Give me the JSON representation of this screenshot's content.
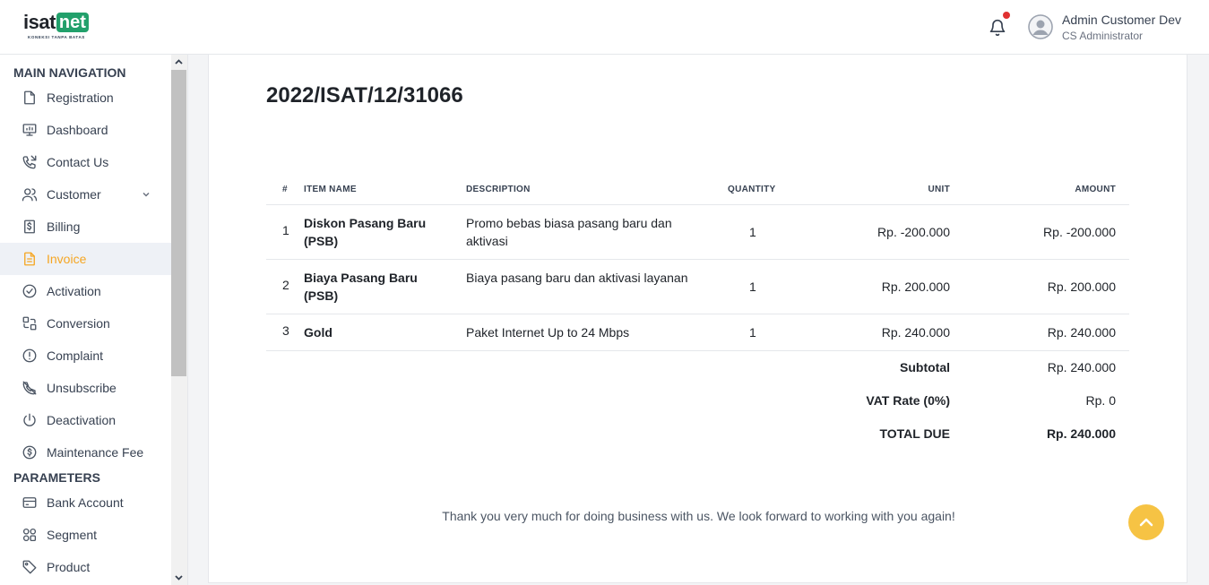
{
  "header": {
    "logo_text_left": "isat",
    "logo_text_right": "net",
    "logo_tagline": "KONEKSI TANPA BATAS",
    "user_name": "Admin Customer Dev",
    "user_role": "CS Administrator"
  },
  "sidebar": {
    "sections": [
      {
        "title": "MAIN NAVIGATION"
      },
      {
        "title": "PARAMETERS"
      }
    ],
    "items": [
      {
        "label": "Registration",
        "icon": "file-icon"
      },
      {
        "label": "Dashboard",
        "icon": "monitor-chart-icon"
      },
      {
        "label": "Contact Us",
        "icon": "phone-call-icon"
      },
      {
        "label": "Customer",
        "icon": "users-icon"
      },
      {
        "label": "Billing",
        "icon": "billing-dollar-icon"
      },
      {
        "label": "Invoice",
        "icon": "invoice-file-icon"
      },
      {
        "label": "Activation",
        "icon": "check-circle-icon"
      },
      {
        "label": "Conversion",
        "icon": "conversion-icon"
      },
      {
        "label": "Complaint",
        "icon": "alert-circle-icon"
      },
      {
        "label": "Unsubscribe",
        "icon": "phone-off-icon"
      },
      {
        "label": "Deactivation",
        "icon": "power-icon"
      },
      {
        "label": "Maintenance Fee",
        "icon": "dollar-circle-icon"
      },
      {
        "label": "Bank Account",
        "icon": "credit-card-icon"
      },
      {
        "label": "Segment",
        "icon": "grid-icon"
      },
      {
        "label": "Product",
        "icon": "tag-icon"
      }
    ],
    "active_item": "Invoice",
    "accent_color": "#f5a623"
  },
  "invoice": {
    "number": "2022/ISAT/12/31066",
    "columns": [
      "#",
      "ITEM NAME",
      "DESCRIPTION",
      "QUANTITY",
      "UNIT",
      "AMOUNT"
    ],
    "rows": [
      {
        "no": "1",
        "item": "Diskon Pasang Baru (PSB)",
        "description": "Promo bebas biasa pasang baru dan aktivasi",
        "quantity": "1",
        "unit": "Rp. -200.000",
        "amount": "Rp. -200.000"
      },
      {
        "no": "2",
        "item": "Biaya Pasang Baru (PSB)",
        "description": "Biaya pasang baru dan aktivasi layanan",
        "quantity": "1",
        "unit": "Rp. 200.000",
        "amount": "Rp. 200.000"
      },
      {
        "no": "3",
        "item": "Gold",
        "description": "Paket Internet Up to 24 Mbps",
        "quantity": "1",
        "unit": "Rp. 240.000",
        "amount": "Rp. 240.000"
      }
    ],
    "subtotal_label": "Subtotal",
    "subtotal_value": "Rp. 240.000",
    "vat_label": "VAT Rate (0%)",
    "vat_value": "Rp. 0",
    "total_label": "TOTAL DUE",
    "total_value": "Rp. 240.000",
    "thanks": "Thank you very much for doing business with us. We look forward to working with you again!"
  },
  "colors": {
    "brand_green": "#22a06b",
    "notification_dot": "#e03131",
    "scroll_top_button": "#f6c344"
  }
}
